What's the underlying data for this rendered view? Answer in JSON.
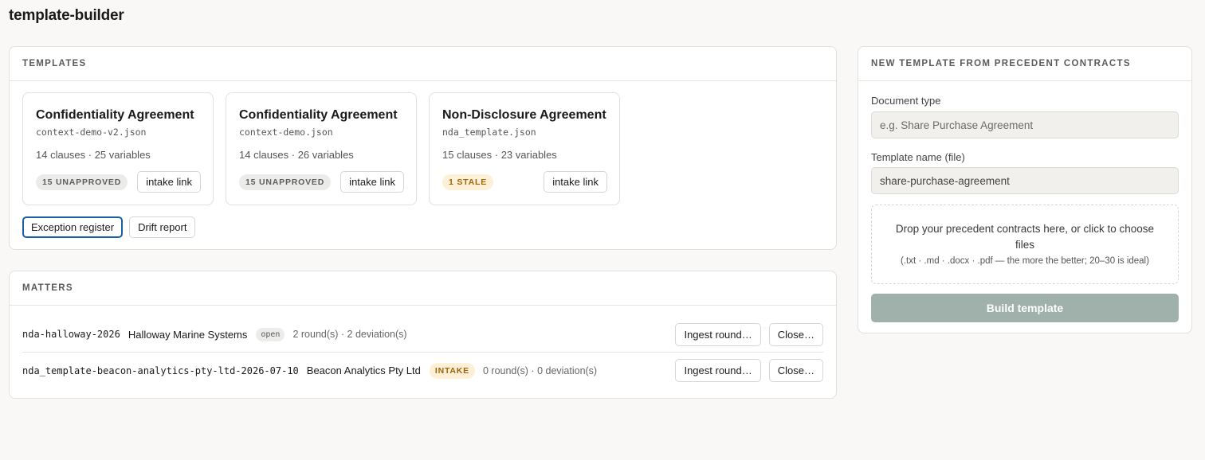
{
  "app": {
    "title": "template-builder"
  },
  "templates": {
    "heading": "TEMPLATES",
    "cards": [
      {
        "title": "Confidentiality Agreement",
        "file": "context-demo-v2.json",
        "meta": "14 clauses · 25 variables",
        "badge": "15 UNAPPROVED",
        "badge_kind": "neutral",
        "link_label": "intake link"
      },
      {
        "title": "Confidentiality Agreement",
        "file": "context-demo.json",
        "meta": "14 clauses · 26 variables",
        "badge": "15 UNAPPROVED",
        "badge_kind": "neutral",
        "link_label": "intake link"
      },
      {
        "title": "Non-Disclosure Agreement",
        "file": "nda_template.json",
        "meta": "15 clauses · 23 variables",
        "badge": "1 STALE",
        "badge_kind": "warning",
        "link_label": "intake link"
      }
    ],
    "actions": {
      "exception_register": "Exception register",
      "drift_report": "Drift report"
    }
  },
  "matters": {
    "heading": "MATTERS",
    "rows": [
      {
        "slug": "nda-halloway-2026",
        "name": "Halloway Marine Systems",
        "status": "open",
        "counts": "2 round(s) · 2 deviation(s)",
        "ingest_label": "Ingest round…",
        "close_label": "Close…"
      },
      {
        "slug": "nda_template-beacon-analytics-pty-ltd-2026-07-10",
        "name": "Beacon Analytics Pty Ltd",
        "status": "INTAKE",
        "counts": "0 round(s) · 0 deviation(s)",
        "ingest_label": "Ingest round…",
        "close_label": "Close…"
      }
    ]
  },
  "new_template": {
    "heading": "NEW TEMPLATE FROM PRECEDENT CONTRACTS",
    "doc_type_label": "Document type",
    "doc_type_placeholder": "e.g. Share Purchase Agreement",
    "doc_type_value": "",
    "template_name_label": "Template name (file)",
    "template_name_value": "share-purchase-agreement",
    "dropzone_text": "Drop your precedent contracts here, or click to choose files",
    "dropzone_hint": "(.txt · .md · .docx · .pdf — the more the better; 20–30 is ideal)",
    "build_label": "Build template"
  },
  "colors": {
    "accent_focus": "#1a5fa3",
    "warning_bg": "#fdf0d6",
    "warning_text": "#a0650c",
    "build_button_disabled": "#9fb1aa"
  }
}
